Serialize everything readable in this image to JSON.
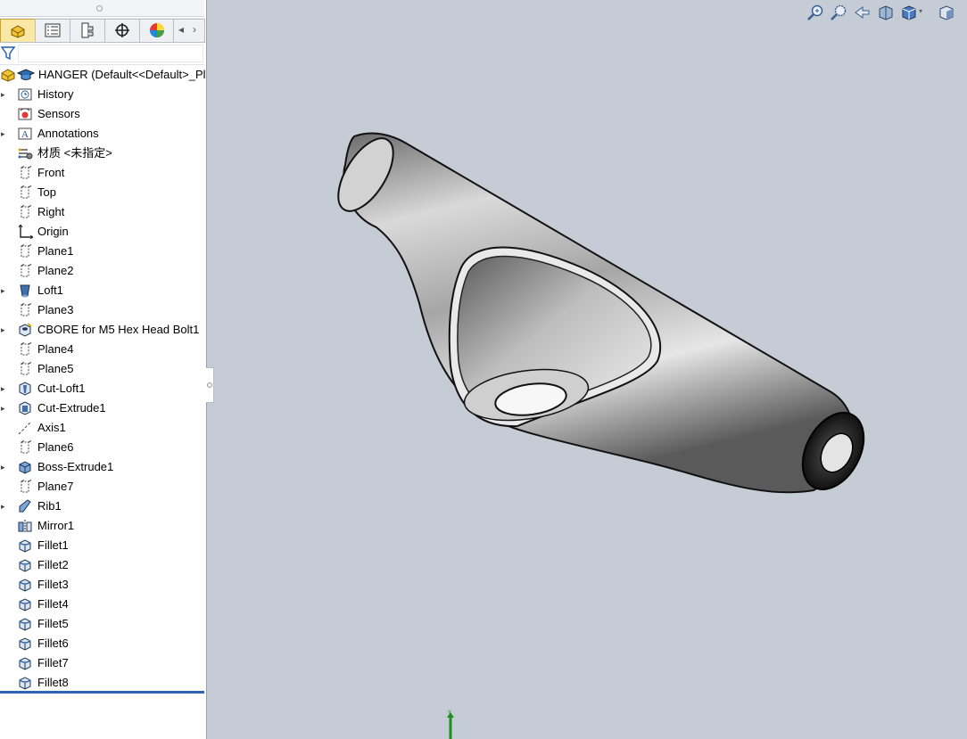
{
  "panel": {
    "tabs": [
      {
        "icon": "feature-manager-icon",
        "active": true
      },
      {
        "icon": "property-manager-icon",
        "active": false
      },
      {
        "icon": "configuration-manager-icon",
        "active": false
      },
      {
        "icon": "dimxpert-manager-icon",
        "active": false
      },
      {
        "icon": "display-manager-icon",
        "active": false
      }
    ],
    "filter_icon": "filter-icon"
  },
  "tree": {
    "root_label": "HANGER  (Default<<Default>_Pl",
    "items": [
      {
        "label": "History",
        "icon": "history-icon",
        "expandable": true
      },
      {
        "label": "Sensors",
        "icon": "sensors-icon",
        "expandable": false
      },
      {
        "label": "Annotations",
        "icon": "annotations-icon",
        "expandable": true
      },
      {
        "label": "材质 <未指定>",
        "icon": "material-icon",
        "expandable": false
      },
      {
        "label": "Front",
        "icon": "plane-icon",
        "expandable": false
      },
      {
        "label": "Top",
        "icon": "plane-icon",
        "expandable": false
      },
      {
        "label": "Right",
        "icon": "plane-icon",
        "expandable": false
      },
      {
        "label": "Origin",
        "icon": "origin-icon",
        "expandable": false
      },
      {
        "label": "Plane1",
        "icon": "plane-icon",
        "expandable": false
      },
      {
        "label": "Plane2",
        "icon": "plane-icon",
        "expandable": false
      },
      {
        "label": "Loft1",
        "icon": "loft-icon",
        "expandable": true
      },
      {
        "label": "Plane3",
        "icon": "plane-icon",
        "expandable": false
      },
      {
        "label": "CBORE for M5 Hex Head Bolt1",
        "icon": "hole-wizard-icon",
        "expandable": true
      },
      {
        "label": "Plane4",
        "icon": "plane-icon",
        "expandable": false
      },
      {
        "label": "Plane5",
        "icon": "plane-icon",
        "expandable": false
      },
      {
        "label": "Cut-Loft1",
        "icon": "cut-loft-icon",
        "expandable": true
      },
      {
        "label": "Cut-Extrude1",
        "icon": "cut-extrude-icon",
        "expandable": true
      },
      {
        "label": "Axis1",
        "icon": "axis-icon",
        "expandable": false
      },
      {
        "label": "Plane6",
        "icon": "plane-icon",
        "expandable": false
      },
      {
        "label": "Boss-Extrude1",
        "icon": "boss-extrude-icon",
        "expandable": true
      },
      {
        "label": "Plane7",
        "icon": "plane-icon",
        "expandable": false
      },
      {
        "label": "Rib1",
        "icon": "rib-icon",
        "expandable": true
      },
      {
        "label": "Mirror1",
        "icon": "mirror-icon",
        "expandable": false
      },
      {
        "label": "Fillet1",
        "icon": "fillet-icon",
        "expandable": false
      },
      {
        "label": "Fillet2",
        "icon": "fillet-icon",
        "expandable": false
      },
      {
        "label": "Fillet3",
        "icon": "fillet-icon",
        "expandable": false
      },
      {
        "label": "Fillet4",
        "icon": "fillet-icon",
        "expandable": false
      },
      {
        "label": "Fillet5",
        "icon": "fillet-icon",
        "expandable": false
      },
      {
        "label": "Fillet6",
        "icon": "fillet-icon",
        "expandable": false
      },
      {
        "label": "Fillet7",
        "icon": "fillet-icon",
        "expandable": false
      },
      {
        "label": "Fillet8",
        "icon": "fillet-icon",
        "expandable": false
      }
    ]
  },
  "viewport": {
    "background": "#c6ccd6",
    "toolbar": [
      "zoom-to-fit-icon",
      "zoom-to-area-icon",
      "previous-view-icon",
      "section-view-icon",
      "view-orientation-icon",
      "display-style-icon"
    ]
  },
  "colors": {
    "accent": "#2d63b3",
    "active_tab": "#fbe7a6"
  }
}
